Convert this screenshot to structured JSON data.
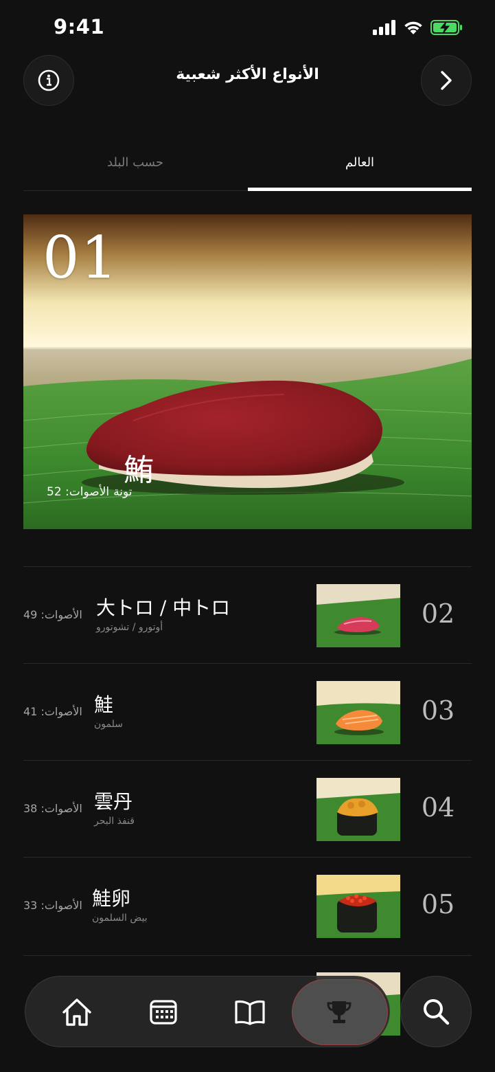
{
  "status": {
    "time": "9:41"
  },
  "header": {
    "title": "الأنواع الأكثر شعبية"
  },
  "tabs": {
    "country": "حسب البلد",
    "world": "العالم"
  },
  "hero": {
    "rank": "01",
    "kanji": "鮪",
    "name": "تونة",
    "votes": "الأصوات: 52"
  },
  "list": [
    {
      "rank": "02",
      "title": "大トロ / 中トロ",
      "subtitle": "أوتورو / تشوتورو",
      "votes": "الأصوات: 49",
      "fish": "fatty-tuna"
    },
    {
      "rank": "03",
      "title": "鮭",
      "subtitle": "سلمون",
      "votes": "الأصوات: 41",
      "fish": "salmon"
    },
    {
      "rank": "04",
      "title": "雲丹",
      "subtitle": "قنفذ البحر",
      "votes": "الأصوات: 38",
      "fish": "uni"
    },
    {
      "rank": "05",
      "title": "鮭卵",
      "subtitle": "بيض السلمون",
      "votes": "الأصوات: 33",
      "fish": "ikura"
    }
  ],
  "tabbar": [
    "home-icon",
    "calendar-icon",
    "book-icon",
    "trophy-icon"
  ],
  "colors": {
    "background": "#121111",
    "leaf": "#3f8a2f",
    "tuna": "#8e1a1e",
    "accent_border": "#c83c3c"
  }
}
